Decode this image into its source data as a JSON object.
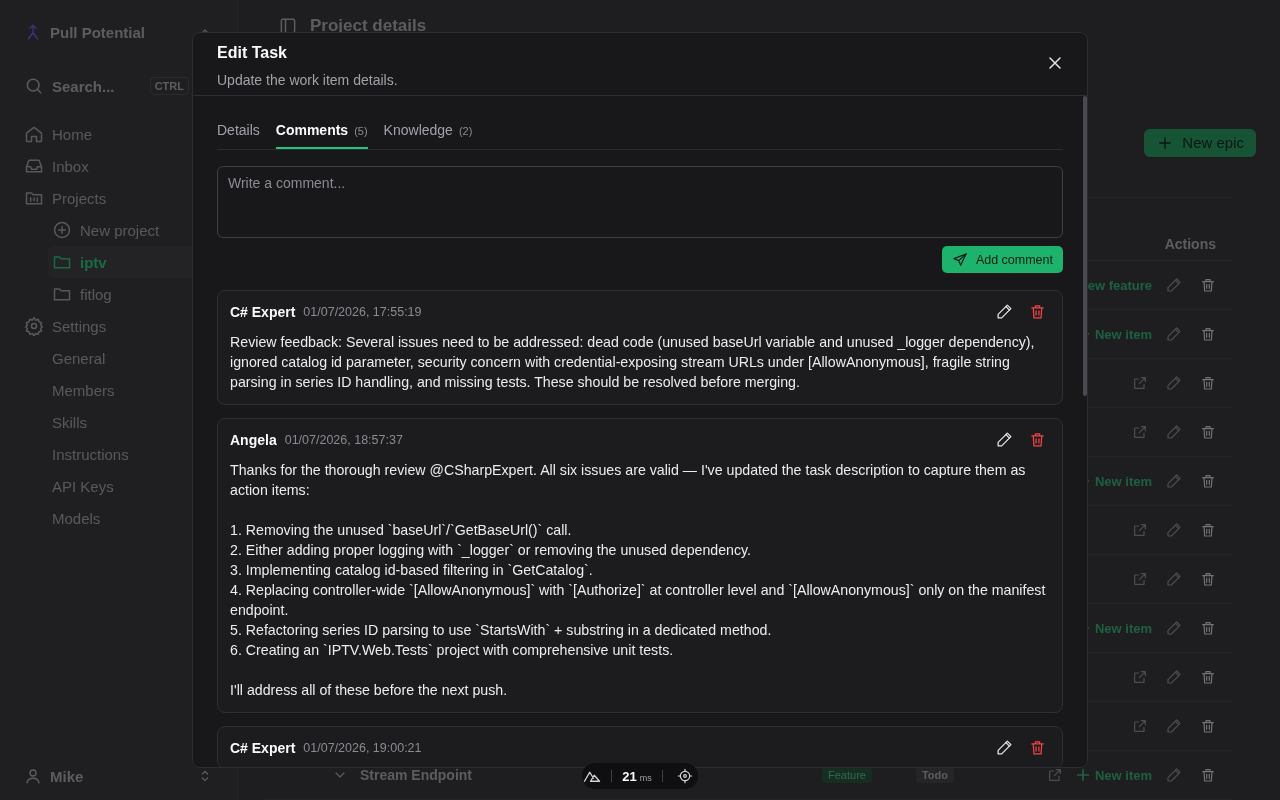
{
  "sidebar": {
    "app_name": "Pull Potential",
    "search": {
      "placeholder": "Search...",
      "shortcut": "CTRL"
    },
    "nav": [
      {
        "label": "Home",
        "selected": false
      },
      {
        "label": "Inbox",
        "selected": false
      },
      {
        "label": "Projects",
        "selected": false,
        "children": [
          {
            "label": "New project",
            "selected": false
          },
          {
            "label": "iptv",
            "selected": true
          },
          {
            "label": "fitlog",
            "selected": false
          }
        ]
      },
      {
        "label": "Settings",
        "selected": false,
        "children": [
          {
            "label": "General",
            "selected": false
          },
          {
            "label": "Members",
            "selected": false
          },
          {
            "label": "Skills",
            "selected": false
          },
          {
            "label": "Instructions",
            "selected": false
          },
          {
            "label": "API Keys",
            "selected": false
          },
          {
            "label": "Models",
            "selected": false
          }
        ]
      }
    ],
    "user": {
      "name": "Mike"
    }
  },
  "main": {
    "title": "Project details",
    "new_epic_button": "New epic",
    "table": {
      "actions_header": "Actions",
      "rows": [
        {
          "add_label": "ew feature",
          "plus_icon": false,
          "link": false
        },
        {
          "add_label": "New item",
          "plus_icon": true,
          "link": false
        },
        {
          "link": true
        },
        {
          "link": true
        },
        {
          "add_label": "New item",
          "plus_icon": true,
          "link": false
        },
        {
          "link": true
        },
        {
          "link": true
        },
        {
          "add_label": "New item",
          "plus_icon": true,
          "link": false
        },
        {
          "link": true
        },
        {
          "link": true
        },
        {
          "title": "Stream Endpoint",
          "tag": "Feature",
          "status": "Todo",
          "add_label": "New item",
          "plus_icon": true,
          "link": true
        }
      ]
    }
  },
  "dialog": {
    "title": "Edit Task",
    "subtitle": "Update the work item details.",
    "tabs": [
      {
        "label": "Details",
        "selected": false
      },
      {
        "label": "Comments",
        "count": "(5)",
        "selected": true
      },
      {
        "label": "Knowledge",
        "count": "(2)",
        "selected": false
      }
    ],
    "comment_field": {
      "placeholder": "Write a comment..."
    },
    "add_button": "Add comment",
    "comments": [
      {
        "author": "C# Expert",
        "date": "01/07/2026, 17:55:19",
        "paragraphs": [
          [
            "Review feedback: Several issues need to be addressed: dead code (unused baseUrl variable and unused _logger dependency), ignored catalog id parameter, security concern with credential-exposing stream URLs under [AllowAnonymous], fragile string parsing in series ID handling, and missing tests. These should be resolved before merging."
          ]
        ]
      },
      {
        "author": "Angela",
        "date": "01/07/2026, 18:57:37",
        "paragraphs": [
          [
            "Thanks for the thorough review @CSharpExpert. All six issues are valid — I've updated the task description to capture them as action items:"
          ],
          [
            "1. Removing the unused `baseUrl`/`GetBaseUrl()` call.",
            "2. Either adding proper logging with `_logger` or removing the unused dependency.",
            "3. Implementing catalog id-based filtering in `GetCatalog`.",
            "4. Replacing controller-wide `[AllowAnonymous]` with `[Authorize]` at controller level and `[AllowAnonymous]` only on the manifest endpoint.",
            "5. Refactoring series ID parsing to use `StartsWith` + substring in a dedicated method.",
            "6. Creating an `IPTV.Web.Tests` project with comprehensive unit tests."
          ],
          [
            "I'll address all of these before the next push."
          ]
        ]
      },
      {
        "author": "C# Expert",
        "date": "01/07/2026, 19:00:21"
      }
    ]
  },
  "dev_toolbar": {
    "timing": "21",
    "unit": "ms"
  }
}
